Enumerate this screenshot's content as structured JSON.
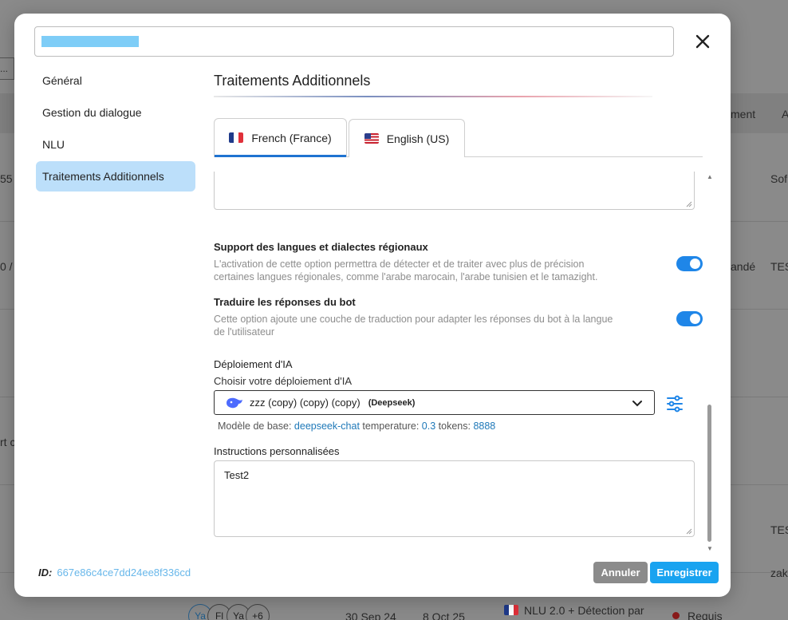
{
  "background": {
    "left_texts": [
      "...",
      "55 1",
      "0 /",
      "rt c"
    ],
    "right_texts": [
      "ment",
      "A",
      "Sof",
      "andé",
      "TES",
      "TES",
      "zak"
    ],
    "avatars": [
      "Ya",
      "Fl",
      "Ya",
      "+6"
    ],
    "dates": [
      "30 Sep 24",
      "8 Oct 25"
    ],
    "nlu_text": "NLU 2.0 + Détection par",
    "status_text": "Requis"
  },
  "modal": {
    "close_label": "✕",
    "sidebar": {
      "items": [
        {
          "label": "Général"
        },
        {
          "label": "Gestion du dialogue"
        },
        {
          "label": "NLU"
        },
        {
          "label": "Traitements Additionnels"
        }
      ]
    },
    "content": {
      "title": "Traitements Additionnels",
      "tabs": [
        {
          "label": "French (France)"
        },
        {
          "label": "English (US)"
        }
      ],
      "options": [
        {
          "label": "Support des langues et dialectes régionaux",
          "description": "L'activation de cette option permettra de détecter et de traiter avec plus de précision certaines langues régionales, comme l'arabe marocain, l'arabe tunisien et le tamazight.",
          "enabled": true
        },
        {
          "label": "Traduire les réponses du bot",
          "description": "Cette option ajoute une couche de traduction pour adapter les réponses du bot à la langue de l'utilisateur",
          "enabled": true
        }
      ],
      "ai": {
        "label": "Déploiement d'IA",
        "sub_label": "Choisir votre déploiement d'IA",
        "selected": "zzz (copy) (copy) (copy)",
        "provider": "(Deepseek)",
        "meta": {
          "base_model_label": "Modèle de base:",
          "base_model": "deepseek-chat",
          "temperature_label": "temperature:",
          "temperature": "0.3",
          "tokens_label": "tokens:",
          "tokens": "8888"
        }
      },
      "instructions": {
        "label": "Instructions personnalisées",
        "value": "Test2"
      }
    },
    "footer": {
      "id_label": "ID:",
      "id_value": "667e86c4ce7dd24ee8f336cd",
      "cancel_label": "Annuler",
      "save_label": "Enregistrer"
    }
  },
  "colors": {
    "accent": "#1f86e8",
    "save": "#19a3f0",
    "cancel": "#8b8b8b",
    "sidebar_active": "#bcdffa",
    "link": "#1e78b8"
  }
}
